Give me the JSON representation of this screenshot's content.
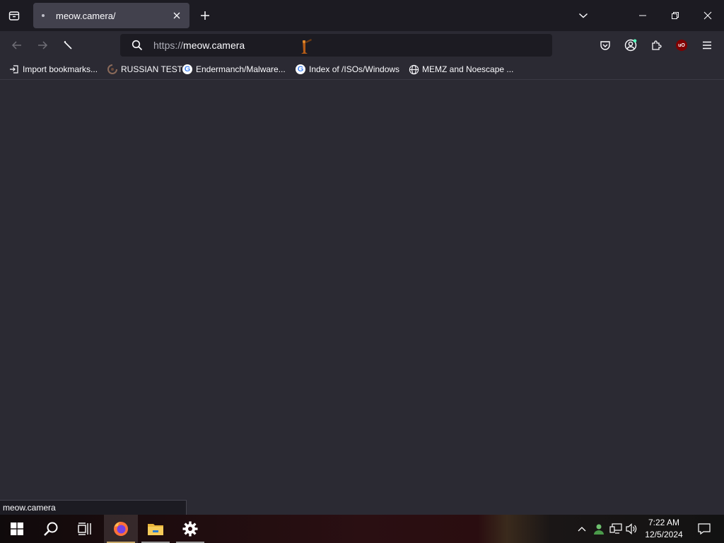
{
  "colors": {
    "chrome_dark": "#1c1b22",
    "chrome": "#2b2a33",
    "tab_active": "#42414d",
    "text": "#fbfbfe",
    "ublock_red": "#800000",
    "account_badge": "#54ffbd"
  },
  "tabs": [
    {
      "title": "meow.camera/",
      "icon": "loading-dot-icon",
      "active": true
    }
  ],
  "urlbar": {
    "scheme": "https://",
    "host": "meow.camera"
  },
  "bookmarks": [
    {
      "label": "Import bookmarks...",
      "icon": "import-icon"
    },
    {
      "label": "RUSSIAN TEST",
      "icon": "favicon-icon"
    },
    {
      "label": "Endermanch/Malware...",
      "icon": "google-icon"
    },
    {
      "label": "Index of /ISOs/Windows",
      "icon": "google-icon"
    },
    {
      "label": "MEMZ and Noescape ...",
      "icon": "globe-icon"
    }
  ],
  "status_text": "meow.camera",
  "extensions": {
    "ublock_label": "uO"
  },
  "google_glyph": "G",
  "taskbar": {
    "apps": [
      "start-icon",
      "search-icon",
      "task-view-icon",
      "firefox-icon",
      "file-explorer-icon",
      "settings-icon"
    ],
    "time": "7:22 AM",
    "date": "12/5/2024"
  }
}
